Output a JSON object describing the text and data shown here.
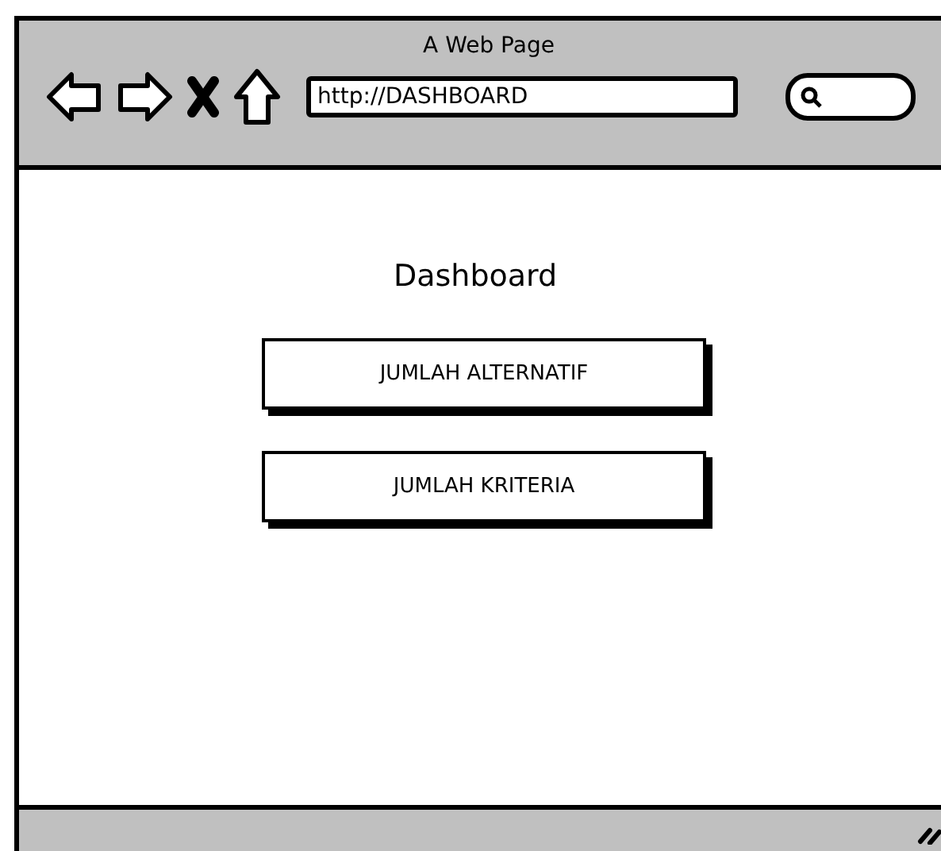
{
  "window": {
    "title": "A Web Page"
  },
  "address_bar": {
    "value": "http://DASHBOARD"
  },
  "page": {
    "heading": "Dashboard",
    "buttons": [
      {
        "label": "JUMLAH ALTERNATIF"
      },
      {
        "label": "JUMLAH KRITERIA"
      }
    ]
  }
}
